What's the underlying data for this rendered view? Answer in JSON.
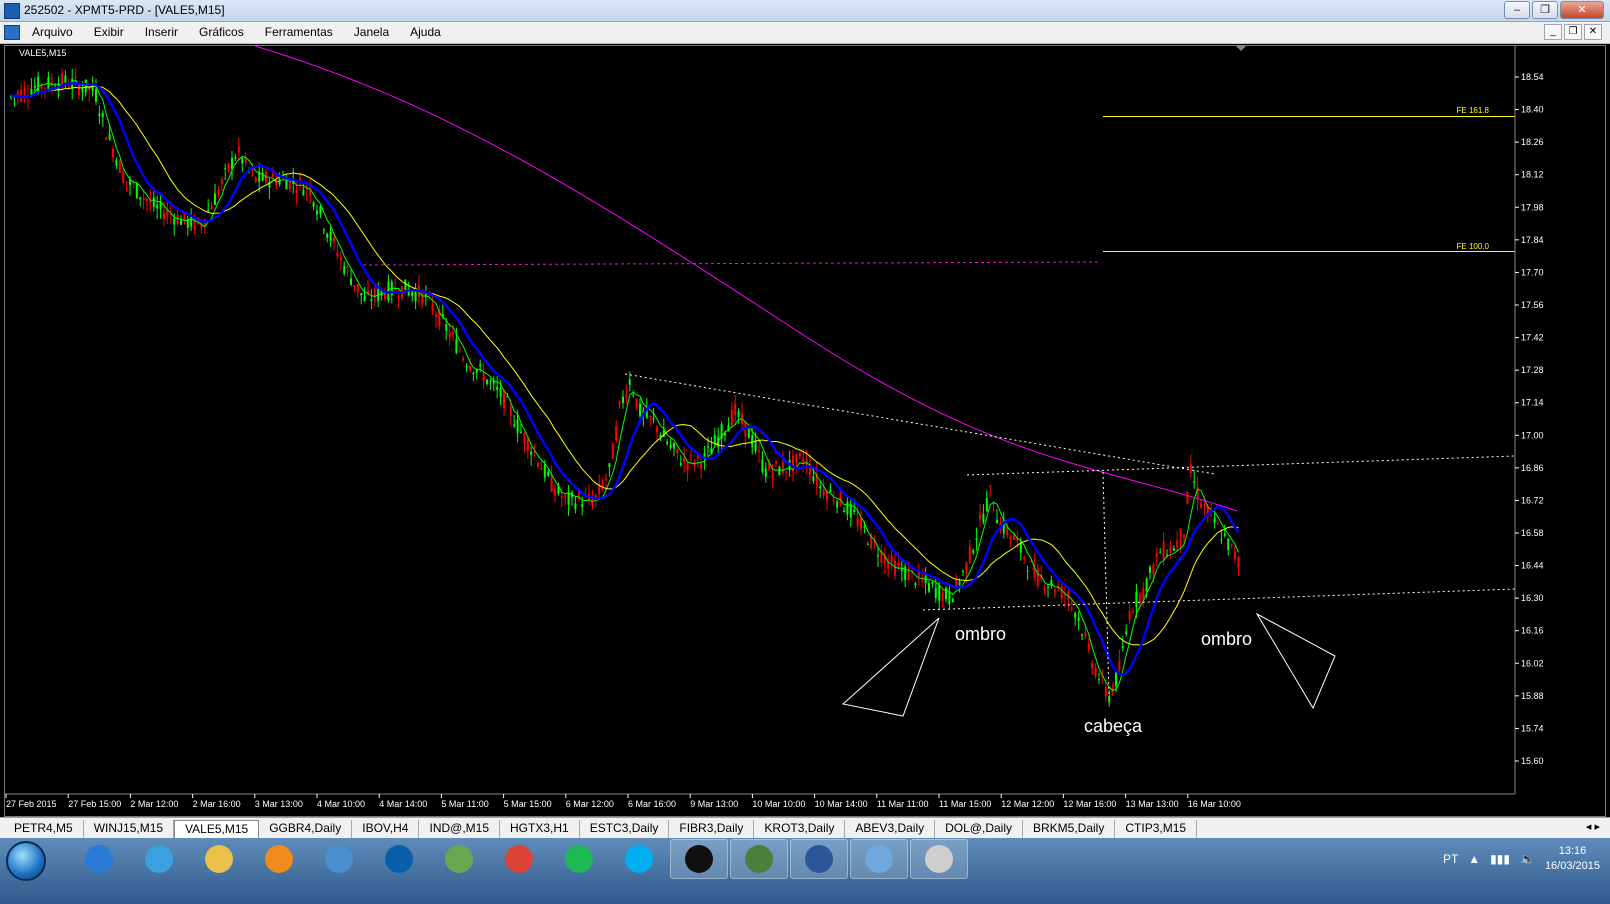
{
  "window": {
    "title": "252502 - XPMT5-PRD - [VALE5,M15]"
  },
  "menu": [
    "Arquivo",
    "Exibir",
    "Inserir",
    "Gráficos",
    "Ferramentas",
    "Janela",
    "Ajuda"
  ],
  "chart": {
    "symbol_label": "VALE5,M15",
    "price_labels": [
      "18.54",
      "18.40",
      "18.26",
      "18.12",
      "17.98",
      "17.84",
      "17.70",
      "17.56",
      "17.42",
      "17.28",
      "17.14",
      "17.00",
      "16.86",
      "16.72",
      "16.58",
      "16.44",
      "16.30",
      "16.16",
      "16.02",
      "15.88",
      "15.74",
      "15.60"
    ],
    "time_labels": [
      "27 Feb 2015",
      "27 Feb 15:00",
      "2 Mar 12:00",
      "2 Mar 16:00",
      "3 Mar 13:00",
      "4 Mar 10:00",
      "4 Mar 14:00",
      "5 Mar 11:00",
      "5 Mar 15:00",
      "6 Mar 12:00",
      "6 Mar 16:00",
      "9 Mar 13:00",
      "10 Mar 10:00",
      "10 Mar 14:00",
      "11 Mar 11:00",
      "11 Mar 15:00",
      "12 Mar 12:00",
      "12 Mar 16:00",
      "13 Mar 13:00",
      "16 Mar 10:00"
    ],
    "fib_labels": {
      "fe161": "FE 161.8",
      "fe100": "FE 100.0"
    },
    "fib_levels": {
      "fe161": 18.37,
      "fe100": 17.79
    },
    "annotations": {
      "left_shoulder": "ombro",
      "right_shoulder": "ombro",
      "head": "cabeça"
    },
    "colors": {
      "bull": "#00ff00",
      "bear": "#ff0000",
      "ma_fast": "#00ff00",
      "ma_mid": "#0000ff",
      "ma_slow": "#ffff00",
      "ma_long": "#ff00ff",
      "fib": "#ffff00",
      "axis": "#ffffff"
    }
  },
  "tabs": [
    "PETR4,M5",
    "WINJ15,M15",
    "VALE5,M15",
    "GGBR4,Daily",
    "IBOV,H4",
    "IND@,M15",
    "HGTX3,H1",
    "ESTC3,Daily",
    "FIBR3,Daily",
    "KROT3,Daily",
    "ABEV3,Daily",
    "DOL@,Daily",
    "BRKM5,Daily",
    "CTIP3,M15"
  ],
  "active_tab": "VALE5,M15",
  "taskbar": {
    "icons": [
      "windows-explorer-icon",
      "internet-explorer-icon",
      "folder-icon",
      "media-player-icon",
      "network-icon",
      "hp-icon",
      "metatrader-icon",
      "chrome-icon",
      "spotify-icon",
      "skype-icon",
      "xp-icon",
      "terminal-icon",
      "word-icon",
      "photo-icon",
      "paint-icon"
    ],
    "language": "PT",
    "time": "13:16",
    "date": "16/03/2015"
  }
}
